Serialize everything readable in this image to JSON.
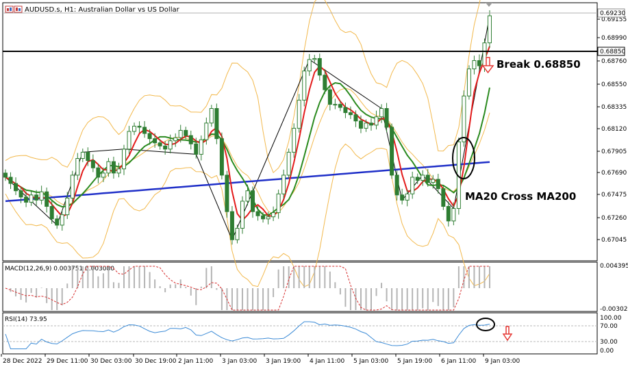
{
  "header": {
    "symbol_line": "AUDUSD.s, H1:  Australian Dollar vs US Dollar"
  },
  "main_panel": {
    "price_ticks": [
      "0.69155",
      "0.68990",
      "0.68760",
      "0.68550",
      "0.68335",
      "0.68120",
      "0.67905",
      "0.67690",
      "0.67475",
      "0.67260",
      "0.67045"
    ],
    "current_price_label": "0.69230",
    "break_level_label": "0.68850",
    "annotation_break": "Break 0.68850",
    "annotation_cross": "MA20 Cross MA200"
  },
  "macd_panel": {
    "label": "MACD(12,26,9) 0.003751 0.003080",
    "ticks": [
      "0.004395",
      "-0.003022"
    ]
  },
  "rsi_panel": {
    "label": "RSI(14) 73.95",
    "ticks": [
      "100.00",
      "70.00",
      "30.00",
      "0.00"
    ]
  },
  "time_axis": {
    "labels": [
      "28 Dec 2022",
      "29 Dec 11:00",
      "30 Dec 03:00",
      "30 Dec 19:00",
      "2 Jan 11:00",
      "3 Jan 03:00",
      "3 Jan 19:00",
      "4 Jan 11:00",
      "5 Jan 03:00",
      "5 Jan 19:00",
      "6 Jan 11:00",
      "9 Jan 03:00"
    ]
  },
  "colors": {
    "candle": "#2e7d32",
    "bollinger": "#f2b84b",
    "ma_fast": "#e31b1b",
    "ma_mid": "#2a8a1e",
    "ma_slow": "#1f2fc8",
    "macd_signal": "#d62a2a",
    "rsi_line": "#3a8ad6",
    "arrow": "#e53935"
  },
  "chart_data": {
    "type": "line",
    "series": [
      {
        "values": [
          0.6768,
          0.6762,
          0.6755,
          0.6749,
          0.6744,
          0.6751,
          0.6746,
          0.6754,
          0.674,
          0.6728,
          0.6722,
          0.6732,
          0.6748,
          0.677,
          0.6786,
          0.6792,
          0.6784,
          0.6777,
          0.6768,
          0.6772,
          0.6783,
          0.6772,
          0.6776,
          0.6795,
          0.6812,
          0.6817,
          0.6816,
          0.681,
          0.6805,
          0.6801,
          0.6798,
          0.6795,
          0.6803,
          0.6806,
          0.6813,
          0.6808,
          0.68,
          0.679,
          0.6804,
          0.682,
          0.6834,
          0.6805,
          0.677,
          0.6735,
          0.6708,
          0.6719,
          0.6745,
          0.6755,
          0.6735,
          0.6731,
          0.6728,
          0.673,
          0.6734,
          0.6752,
          0.677,
          0.6792,
          0.6815,
          0.6842,
          0.687,
          0.6881,
          0.6882,
          0.6866,
          0.6852,
          0.6838,
          0.6838,
          0.6835,
          0.683,
          0.6828,
          0.6822,
          0.6815,
          0.682,
          0.6818,
          0.6826,
          0.6834,
          0.6816,
          0.677,
          0.6751,
          0.6746,
          0.6752,
          0.6768,
          0.6765,
          0.677,
          0.6763,
          0.6766,
          0.6757,
          0.674,
          0.6726,
          0.6738,
          0.6802,
          0.6846,
          0.6872,
          0.688,
          0.6875,
          0.6897,
          0.6923
        ]
      }
    ],
    "ylim": [
      0.6695,
      0.6925
    ]
  }
}
